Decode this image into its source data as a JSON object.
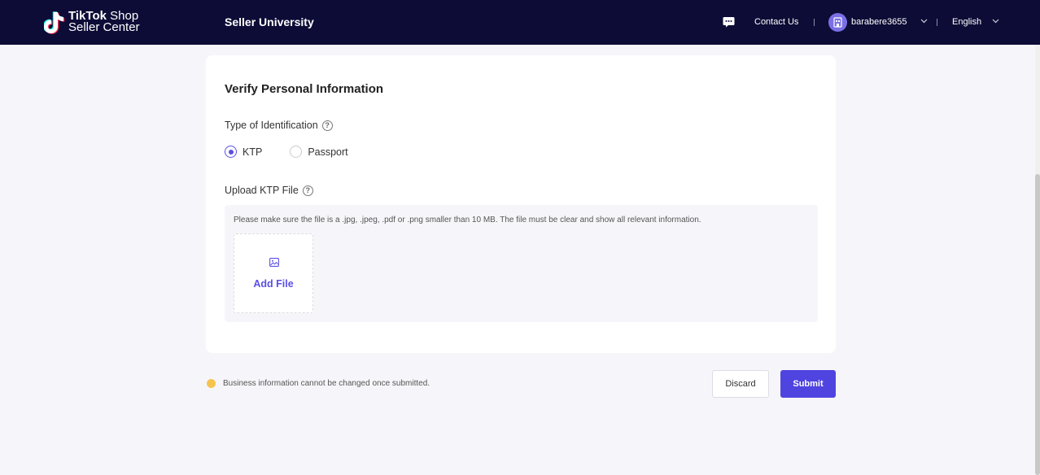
{
  "header": {
    "logo_line1_bold": "TikTok",
    "logo_line1_rest": " Shop",
    "logo_line2": "Seller Center",
    "title": "Seller University",
    "contact_label": "Contact Us",
    "username": "barabere3655",
    "language": "English",
    "icons": [
      "chat-icon",
      "user-avatar-icon",
      "chevron-down-icon"
    ]
  },
  "form": {
    "title": "Verify Personal Information",
    "id_type_label": "Type of Identification",
    "id_options": [
      {
        "label": "KTP",
        "selected": true
      },
      {
        "label": "Passport",
        "selected": false
      }
    ],
    "upload_label": "Upload KTP File",
    "upload_hint": "Please make sure the file is a .jpg, .jpeg, .pdf or .png smaller than 10 MB. The file must be clear and show all relevant information.",
    "add_file_label": "Add File",
    "help_glyph": "?"
  },
  "footer": {
    "notice": "Business information cannot be changed once submitted.",
    "discard_label": "Discard",
    "submit_label": "Submit"
  },
  "colors": {
    "header_bg": "#0d0c36",
    "accent": "#4f44e0",
    "notice_dot": "#f7c34f",
    "page_bg": "#f6f6fa"
  }
}
